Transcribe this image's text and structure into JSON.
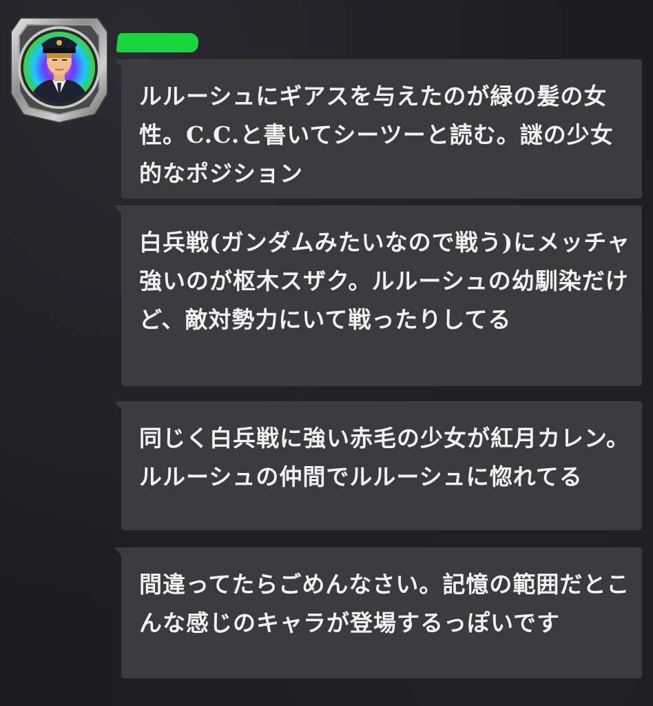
{
  "sender": {
    "avatar_icon": "officer-avatar-icon",
    "username_redaction_color": "#17d640"
  },
  "messages": [
    {
      "text": "ルルーシュにギアスを与えたのが緑の髪の女性。C.C.と書いてシーツーと読む。謎の少女的なポジション"
    },
    {
      "text": "白兵戦(ガンダムみたいなので戦う)にメッチャ強いのが枢木スザク。ルルーシュの幼馴染だけど、敵対勢力にいて戦ったりしてる"
    },
    {
      "text": "同じく白兵戦に強い赤毛の少女が紅月カレン。ルルーシュの仲間でルルーシュに惚れてる"
    },
    {
      "text": "間違ってたらごめんなさい。記憶の範囲だとこんな感じのキャラが登場するっぽいです"
    }
  ],
  "colors": {
    "background": "#1d1d21",
    "bubble": "#3b3b3d",
    "text": "#f2f2f2"
  }
}
